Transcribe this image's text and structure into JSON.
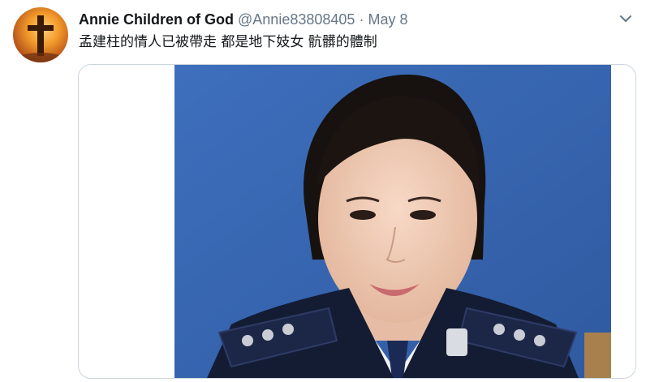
{
  "tweet": {
    "author": {
      "display_name": "Annie Children of God",
      "handle": "@Annie83808405",
      "avatar_icon": "cross-sunset-avatar"
    },
    "separator": "·",
    "date": "May 8",
    "text": "孟建柱的情人已被帶走 都是地下妓女 骯髒的體制",
    "menu_icon": "chevron-down-icon",
    "media": {
      "type": "photo",
      "background_color": "#3a66b0"
    }
  }
}
